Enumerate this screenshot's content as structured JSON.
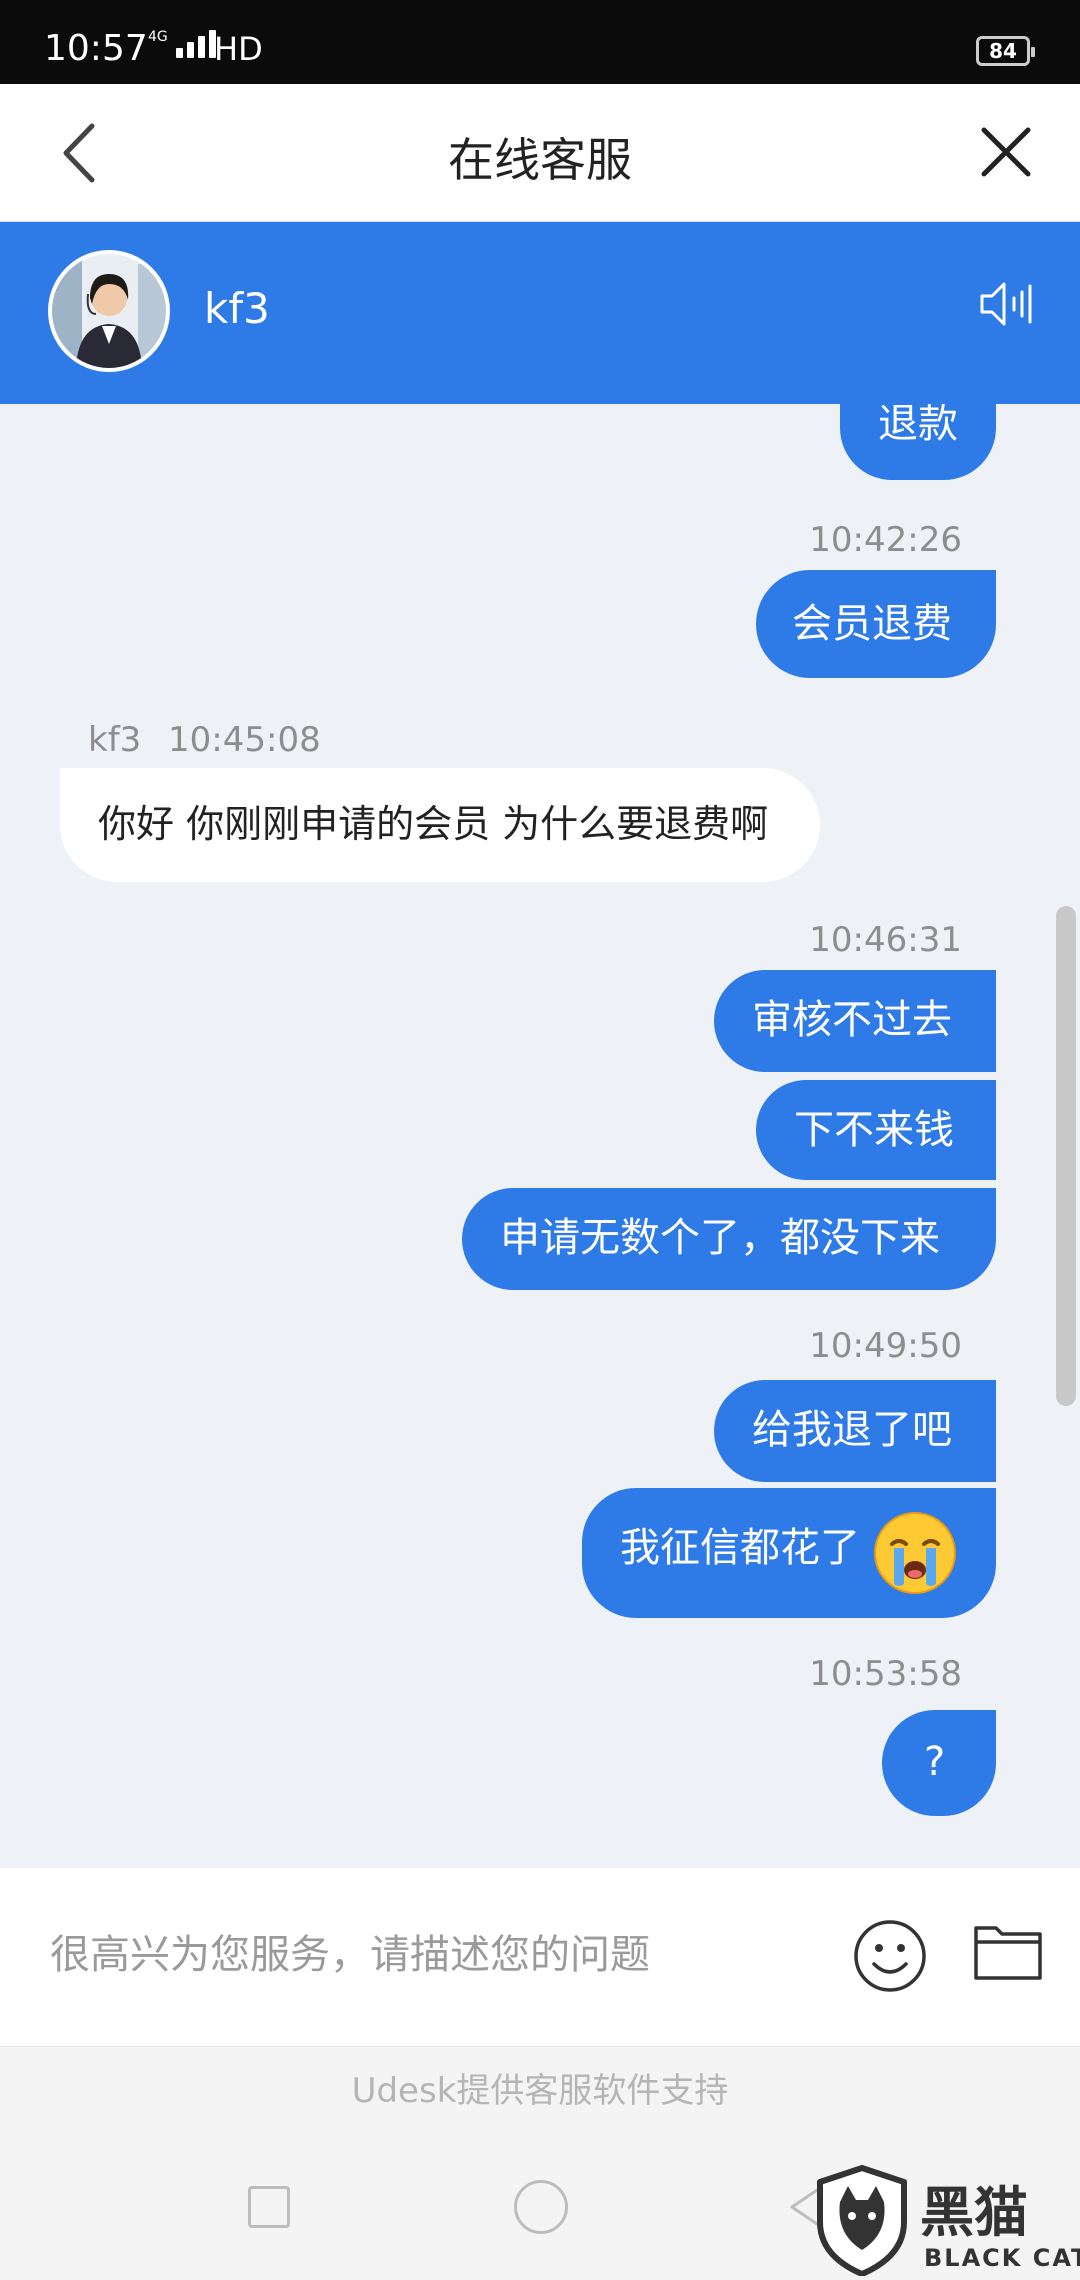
{
  "status_bar": {
    "time": "10:57",
    "network": "4G",
    "hd": "HD",
    "battery": "84"
  },
  "header": {
    "title": "在线客服"
  },
  "agent": {
    "name": "kf3"
  },
  "messages": [
    {
      "id": "m1",
      "type": "outgoing",
      "text": "退款"
    },
    {
      "id": "t1",
      "type": "timestamp",
      "text": "10:42:26"
    },
    {
      "id": "m2",
      "type": "outgoing",
      "text": "会员退费"
    },
    {
      "id": "t2",
      "type": "incoming_meta",
      "sender": "kf3",
      "time": "10:45:08"
    },
    {
      "id": "m3",
      "type": "incoming",
      "text": "你好 你刚刚申请的会员 为什么要退费啊"
    },
    {
      "id": "t3",
      "type": "timestamp",
      "text": "10:46:31"
    },
    {
      "id": "m4",
      "type": "outgoing",
      "text": "审核不过去"
    },
    {
      "id": "m5",
      "type": "outgoing",
      "text": "下不来钱"
    },
    {
      "id": "m6",
      "type": "outgoing",
      "text": "申请无数个了，都没下来"
    },
    {
      "id": "t4",
      "type": "timestamp",
      "text": "10:49:50"
    },
    {
      "id": "m7",
      "type": "outgoing",
      "text": "给我退了吧"
    },
    {
      "id": "m8",
      "type": "outgoing",
      "text": "我征信都花了",
      "emoji": "crying-emoji"
    },
    {
      "id": "t5",
      "type": "timestamp",
      "text": "10:53:58"
    },
    {
      "id": "m9",
      "type": "outgoing",
      "text": "?"
    }
  ],
  "input": {
    "placeholder": "很高兴为您服务，请描述您的问题"
  },
  "footer": {
    "support_text": "Udesk提供客服软件支持"
  },
  "watermark": {
    "text": "黑猫",
    "sub": "BLACK CAT"
  },
  "colors": {
    "accent": "#2e7ae6",
    "status_bar": "#0b0b0b",
    "chat_bg": "#eef1f6"
  }
}
